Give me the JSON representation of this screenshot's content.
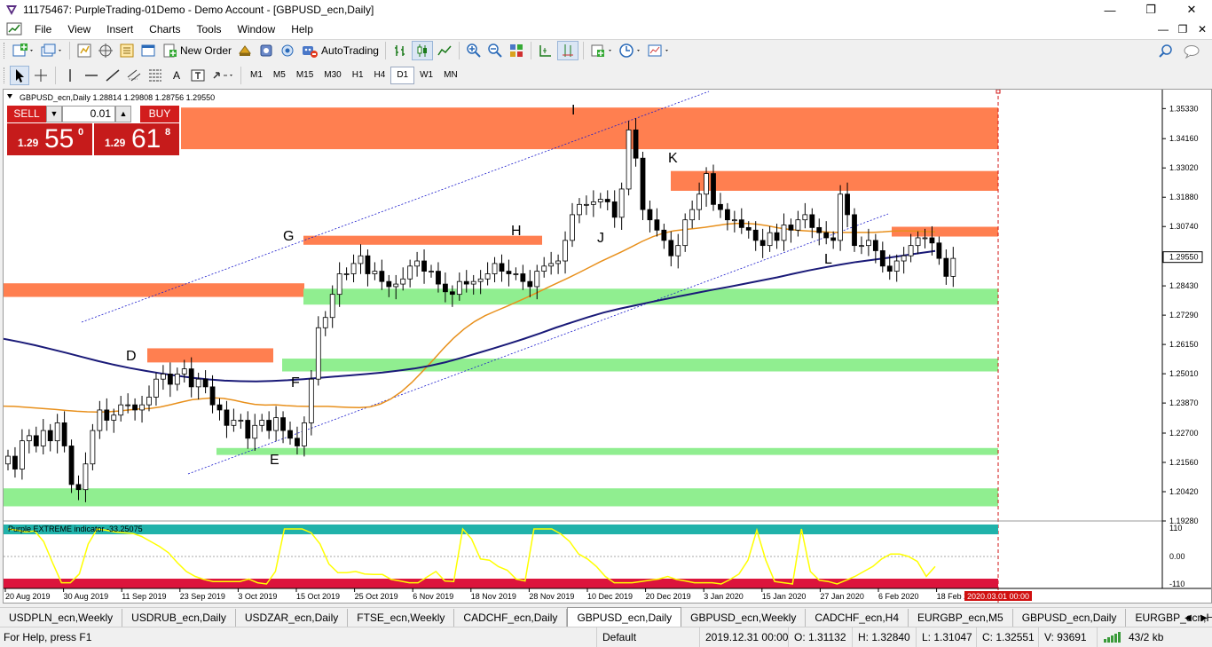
{
  "window": {
    "title": "11175467: PurpleTrading-01Demo - Demo Account - [GBPUSD_ecn,Daily]",
    "controls": [
      "—",
      "❐",
      "✕"
    ]
  },
  "menu": {
    "items": [
      "File",
      "View",
      "Insert",
      "Charts",
      "Tools",
      "Window",
      "Help"
    ],
    "right_controls": [
      "—",
      "❐",
      "✕"
    ]
  },
  "toolbar": {
    "new_order_label": "New Order",
    "autotrading_label": "AutoTrading",
    "text_tool": "A",
    "timeframes": [
      "M1",
      "M5",
      "M15",
      "M30",
      "H1",
      "H4",
      "D1",
      "W1",
      "MN"
    ],
    "active_timeframe": "D1"
  },
  "chart": {
    "info": "GBPUSD_ecn,Daily  1.28814 1.29808 1.28756 1.29550",
    "current_price": "1.29550",
    "indicator_label": "Purple EXTREME indicator -33.25075",
    "cursor_date": "2020.03.01 00:00"
  },
  "trade_panel": {
    "sell_label": "SELL",
    "buy_label": "BUY",
    "lot": "0.01",
    "sell_price_small": "1.29",
    "sell_price_big": "55",
    "sell_price_sup": "0",
    "buy_price_small": "1.29",
    "buy_price_big": "61",
    "buy_price_sup": "8"
  },
  "chart_data": {
    "type": "candlestick",
    "symbol": "GBPUSD_ecn",
    "timeframe": "Daily",
    "ohlc_last": {
      "open": 1.28814,
      "high": 1.29808,
      "low": 1.28756,
      "close": 1.2955
    },
    "price_ticks": [
      "1.35330",
      "1.34160",
      "1.33020",
      "1.31880",
      "1.30740",
      "1.29550",
      "1.28430",
      "1.27290",
      "1.26150",
      "1.25010",
      "1.23870",
      "1.22700",
      "1.21560",
      "1.20420",
      "1.19280"
    ],
    "ylim": [
      1.1928,
      1.3586
    ],
    "indicator_ticks": [
      "110",
      "0.00",
      "-110"
    ],
    "indicator_range": [
      -110,
      110
    ],
    "date_ticks": [
      "20 Aug 2019",
      "30 Aug 2019",
      "11 Sep 2019",
      "23 Sep 2019",
      "3 Oct 2019",
      "15 Oct 2019",
      "25 Oct 2019",
      "6 Nov 2019",
      "18 Nov 2019",
      "28 Nov 2019",
      "10 Dec 2019",
      "20 Dec 2019",
      "3 Jan 2020",
      "15 Jan 2020",
      "27 Jan 2020",
      "6 Feb 2020",
      "18 Feb 2020"
    ],
    "annotations": [
      "I",
      "K",
      "G",
      "H",
      "J",
      "L",
      "D",
      "F",
      "E"
    ],
    "resistance_zones": [
      {
        "from": 1.3375,
        "to": 1.3537
      },
      {
        "from": 1.3213,
        "to": 1.329
      },
      {
        "from": 1.3035,
        "to": 1.3073
      },
      {
        "from": 1.3003,
        "to": 1.3038
      },
      {
        "from": 1.28,
        "to": 1.2853
      },
      {
        "from": 1.2545,
        "to": 1.26
      }
    ],
    "support_zones": [
      {
        "from": 1.277,
        "to": 1.2832
      },
      {
        "from": 1.251,
        "to": 1.256
      },
      {
        "from": 1.2185,
        "to": 1.2212
      },
      {
        "from": 1.1985,
        "to": 1.2055
      }
    ],
    "candle_closes": [
      1.218,
      1.213,
      1.224,
      1.226,
      1.222,
      1.228,
      1.224,
      1.231,
      1.222,
      1.207,
      1.205,
      1.215,
      1.228,
      1.236,
      1.232,
      1.234,
      1.238,
      1.238,
      1.236,
      1.238,
      1.241,
      1.248,
      1.25,
      1.246,
      1.25,
      1.252,
      1.245,
      1.248,
      1.245,
      1.238,
      1.236,
      1.23,
      1.232,
      1.232,
      1.225,
      1.23,
      1.232,
      1.228,
      1.233,
      1.228,
      1.225,
      1.222,
      1.231,
      1.248,
      1.268,
      1.272,
      1.281,
      1.289,
      1.289,
      1.293,
      1.296,
      1.289,
      1.29,
      1.286,
      1.284,
      1.285,
      1.287,
      1.292,
      1.294,
      1.29,
      1.29,
      1.285,
      1.282,
      1.281,
      1.286,
      1.285,
      1.286,
      1.287,
      1.289,
      1.293,
      1.29,
      1.289,
      1.289,
      1.286,
      1.284,
      1.29,
      1.292,
      1.293,
      1.294,
      1.302,
      1.312,
      1.316,
      1.316,
      1.317,
      1.318,
      1.317,
      1.311,
      1.322,
      1.345,
      1.334,
      1.314,
      1.31,
      1.306,
      1.302,
      1.296,
      1.3,
      1.31,
      1.314,
      1.32,
      1.328,
      1.316,
      1.314,
      1.31,
      1.31,
      1.307,
      1.306,
      1.302,
      1.3,
      1.305,
      1.302,
      1.308,
      1.306,
      1.31,
      1.312,
      1.307,
      1.305,
      1.303,
      1.302,
      1.32,
      1.312,
      1.3,
      1.3,
      1.302,
      1.298,
      1.292,
      1.29,
      1.294,
      1.296,
      1.3,
      1.303,
      1.303,
      1.301,
      1.295,
      1.288,
      1.295
    ],
    "indicator_values": [
      110,
      105,
      98,
      102,
      60,
      -25,
      -105,
      -105,
      -70,
      50,
      110,
      105,
      98,
      95,
      92,
      80,
      60,
      40,
      15,
      -25,
      -60,
      -80,
      -92,
      -100,
      -100,
      -100,
      -100,
      -90,
      -105,
      -110,
      -60,
      110,
      110,
      110,
      95,
      50,
      -30,
      -65,
      -65,
      -60,
      -70,
      -72,
      -72,
      -92,
      -98,
      -105,
      -105,
      -82,
      -60,
      -98,
      -100,
      110,
      70,
      -10,
      -15,
      -40,
      -55,
      -90,
      -98,
      110,
      110,
      110,
      90,
      60,
      10,
      -10,
      -40,
      -80,
      -105,
      -105,
      -105,
      -100,
      -95,
      -90,
      -80,
      -92,
      -98,
      -105,
      -105,
      -105,
      -110,
      -92,
      -70,
      -15,
      105,
      -15,
      -100,
      -105,
      -110,
      110,
      -60,
      -95,
      -100,
      -110,
      -95,
      -80,
      -60,
      -40,
      -10,
      10,
      10,
      0,
      -20,
      -80,
      -40
    ],
    "ma_fast": [
      1.2375,
      1.2374,
      1.2371,
      1.2368,
      1.2365,
      1.2362,
      1.2358,
      1.2355,
      1.2353,
      1.2352,
      1.2353,
      1.2356,
      1.236,
      1.2364,
      1.2366,
      1.2372,
      1.2381,
      1.2391,
      1.24,
      1.2404,
      1.2407,
      1.2405,
      1.2398,
      1.2389,
      1.2382,
      1.2379,
      1.238,
      1.2377,
      1.2375,
      1.2374,
      1.2374,
      1.2374,
      1.2372,
      1.237,
      1.2369,
      1.2372,
      1.2383,
      1.2403,
      1.2431,
      1.2467,
      1.2509,
      1.2553,
      1.2598,
      1.264,
      1.2675,
      1.2704,
      1.2727,
      1.2745,
      1.2762,
      1.278,
      1.2798,
      1.2817,
      1.2837,
      1.2856,
      1.2875,
      1.2895,
      1.2916,
      1.2937,
      1.2956,
      1.2975,
      1.2995,
      1.3016,
      1.3034,
      1.3048,
      1.3057,
      1.3062,
      1.3066,
      1.3071,
      1.3077,
      1.3083,
      1.3086,
      1.3086,
      1.3083,
      1.3077,
      1.3069,
      1.3063,
      1.3059,
      1.3056,
      1.3054,
      1.3052,
      1.3051,
      1.3051,
      1.3051,
      1.3051,
      1.3053,
      1.3056,
      1.3057,
      1.3056,
      1.3055,
      1.3053
    ],
    "ma_slow": [
      1.2637,
      1.2625,
      1.2612,
      1.2597,
      1.2582,
      1.2566,
      1.255,
      1.2536,
      1.2523,
      1.2512,
      1.2502,
      1.2493,
      1.2485,
      1.2479,
      1.2474,
      1.2472,
      1.2471,
      1.2473,
      1.2476,
      1.248,
      1.2485,
      1.249,
      1.2495,
      1.25,
      1.2506,
      1.2513,
      1.2521,
      1.2532,
      1.2546,
      1.2563,
      1.2581,
      1.2599,
      1.2618,
      1.2638,
      1.2659,
      1.2681,
      1.2701,
      1.2721,
      1.2739,
      1.2754,
      1.2767,
      1.278,
      1.2793,
      1.2805,
      1.2817,
      1.2829,
      1.284,
      1.2852,
      1.2864,
      1.2876,
      1.289,
      1.2903,
      1.2915,
      1.2926,
      1.2936,
      1.2944,
      1.2952,
      1.2961,
      1.297,
      1.2979
    ]
  },
  "tabs": {
    "items": [
      "USDPLN_ecn,Weekly",
      "USDRUB_ecn,Daily",
      "USDZAR_ecn,Daily",
      "FTSE_ecn,Weekly",
      "CADCHF_ecn,Daily",
      "GBPUSD_ecn,Daily",
      "GBPUSD_ecn,Weekly",
      "CADCHF_ecn,H4",
      "EURGBP_ecn,M5",
      "GBPUSD_ecn,Daily",
      "EURGBP_ecn,H1"
    ],
    "active": 5
  },
  "status": {
    "help": "For Help, press F1",
    "profile": "Default",
    "datetime": "2019.12.31 00:00",
    "open": "O: 1.31132",
    "high": "H: 1.32840",
    "low": "L: 1.31047",
    "close": "C: 1.32551",
    "volume": "V: 93691",
    "traffic": "43/2 kb"
  },
  "colors": {
    "resistance": "#ff7f50",
    "support": "#90ee90",
    "ma_fast": "#e8901c",
    "ma_slow": "#1a1a78",
    "indicator_line": "#ffff00",
    "indicator_top": "#20b2aa",
    "indicator_bottom": "#dc143c",
    "sell": "#d21d1d"
  }
}
